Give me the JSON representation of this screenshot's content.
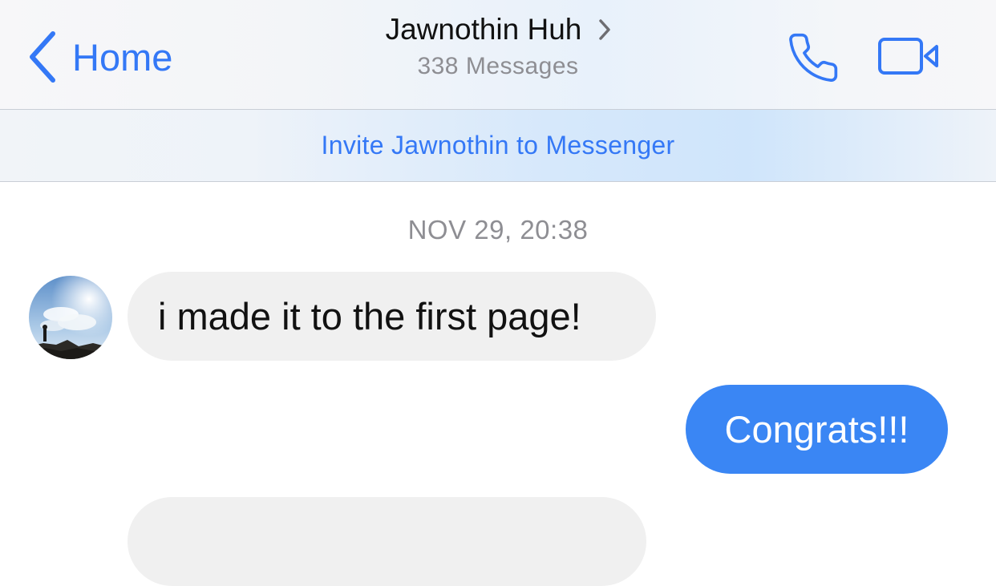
{
  "header": {
    "back_label": "Home",
    "contact_name": "Jawnothin Huh",
    "message_count": "338 Messages"
  },
  "icons": {
    "back": "chevron-left-icon",
    "title": "chevron-right-icon",
    "call": "phone-icon",
    "video": "video-camera-icon"
  },
  "banner": {
    "invite_text": "Invite Jawnothin to Messenger"
  },
  "conversation": {
    "timestamp": "NOV 29, 20:38",
    "messages": [
      {
        "direction": "incoming",
        "text": "i made it to the first page!"
      },
      {
        "direction": "outgoing",
        "text": "Congrats!!!"
      },
      {
        "direction": "incoming",
        "text": ""
      }
    ]
  },
  "colors": {
    "accent": "#3478f6",
    "outgoing_bubble": "#3a86f4",
    "incoming_bubble": "#f0f0f0",
    "secondary_text": "#8e8e93"
  }
}
